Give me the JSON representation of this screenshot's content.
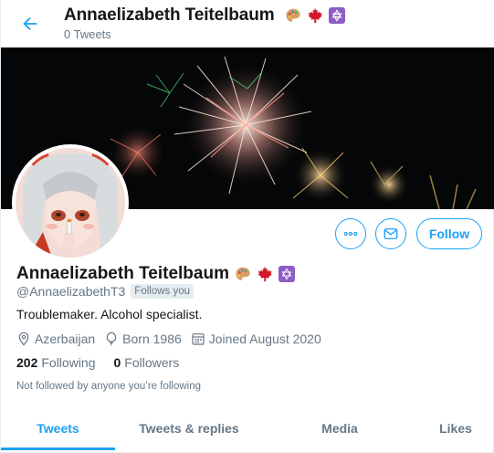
{
  "header": {
    "title": "Annaelizabeth Teitelbaum",
    "subtitle": "0 Tweets"
  },
  "profile": {
    "name": "Annaelizabeth Teitelbaum",
    "handle": "@AnnaelizabethT3",
    "follows_you": "Follows you",
    "bio": "Troublemaker. Alcohol specialist.",
    "location": "Azerbaijan",
    "born": "Born 1986",
    "joined": "Joined August 2020",
    "following_count": "202",
    "following_label": "Following",
    "followers_count": "0",
    "followers_label": "Followers",
    "not_followed": "Not followed by anyone you’re following",
    "name_emojis": [
      "artist-palette",
      "maple-leaf",
      "star-of-david"
    ]
  },
  "actions": {
    "more_icon": "more-icon",
    "message_icon": "envelope-icon",
    "follow_label": "Follow"
  },
  "tabs": [
    {
      "label": "Tweets",
      "active": true
    },
    {
      "label": "Tweets & replies",
      "active": false
    },
    {
      "label": "Media",
      "active": false
    },
    {
      "label": "Likes",
      "active": false
    }
  ],
  "colors": {
    "accent": "#1da1f2",
    "secondary_text": "#657786",
    "primary_text": "#14171a",
    "border": "#e6ecf0",
    "star_badge": "#8c5ec4",
    "maple": "#d5162b"
  }
}
